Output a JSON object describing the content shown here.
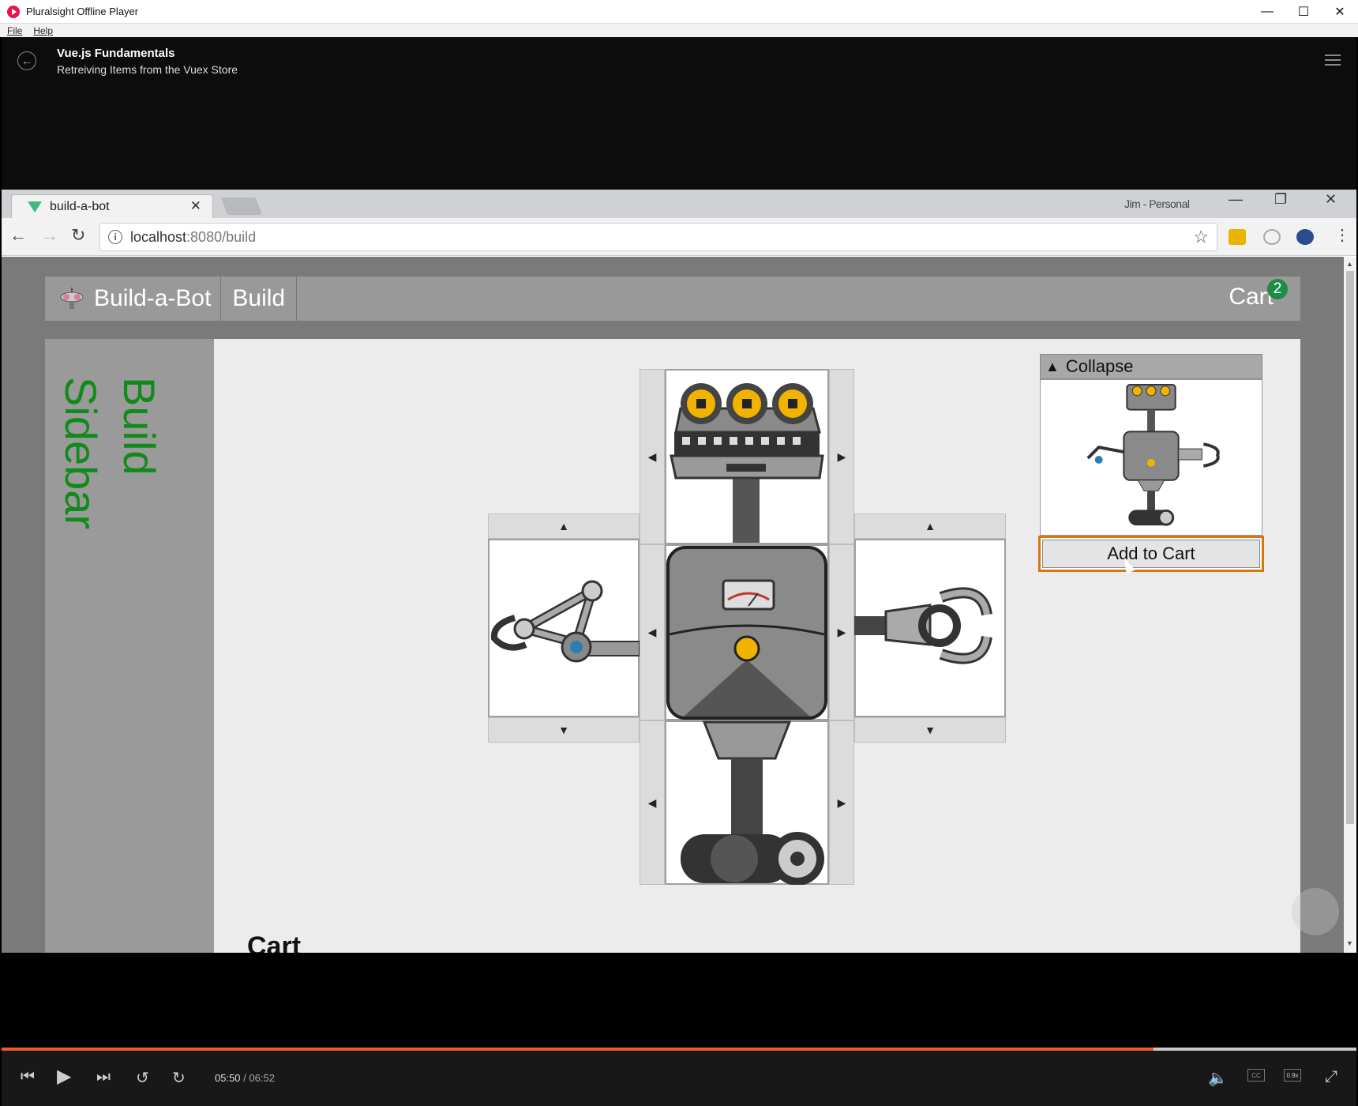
{
  "window": {
    "title": "Pluralsight Offline Player",
    "controls": [
      "—",
      "☐",
      "✕"
    ]
  },
  "menu": {
    "items": [
      "File",
      "Help"
    ]
  },
  "player": {
    "course_title": "Vue.js Fundamentals",
    "clip_title": "Retreiving Items from the Vuex Store"
  },
  "browser": {
    "tab_label": "build-a-bot",
    "profile": "Jim - Personal",
    "url_host": "localhost",
    "url_path": ":8080/build"
  },
  "app": {
    "brand": "Build-a-Bot",
    "nav_build": "Build",
    "cart_label": "Cart",
    "cart_count": "2",
    "sidebar_line1": "Build",
    "sidebar_line2": "Sidebar",
    "collapse_label": "Collapse",
    "add_to_cart": "Add to Cart",
    "cart_heading": "Cart"
  },
  "controls": {
    "current_time": "05:50",
    "separator": "/",
    "duration": "06:52",
    "speed": "0.9x",
    "cc": "CC",
    "progress_fraction": 0.85,
    "accent": "#f15b2a"
  },
  "colors": {
    "sidebar_text": "#118a1a",
    "add_to_cart_focus": "#d9760f",
    "cart_badge": "#1d8c47"
  }
}
